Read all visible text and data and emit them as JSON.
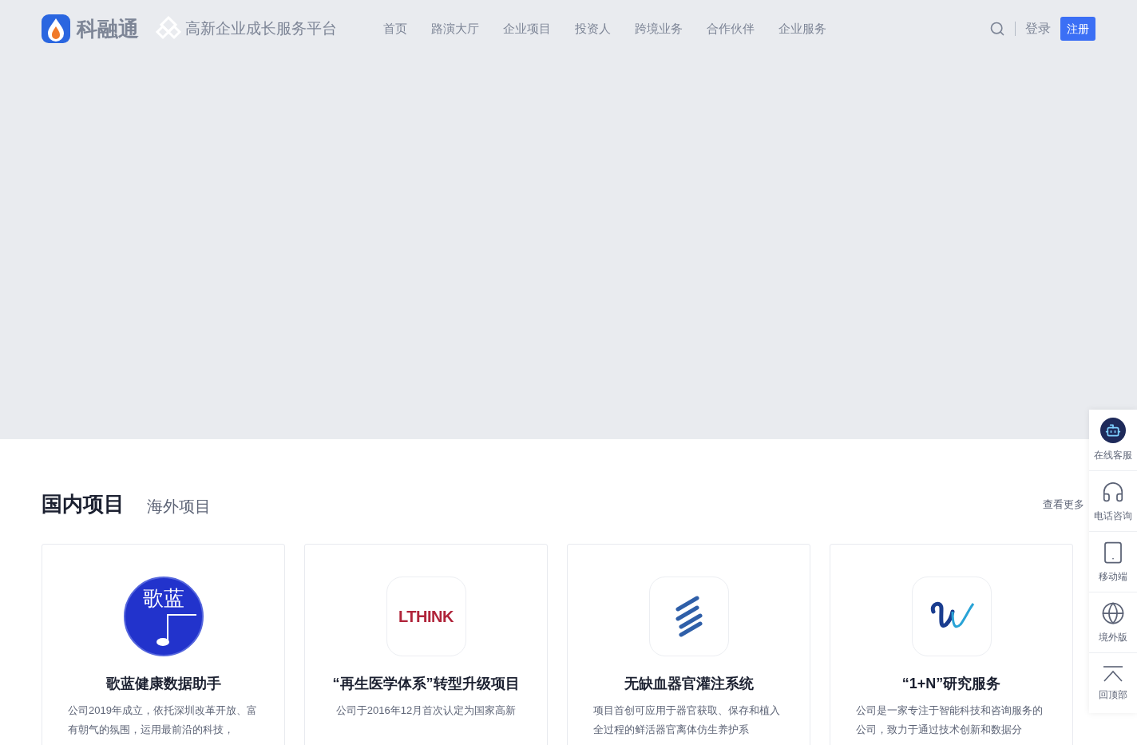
{
  "header": {
    "brand": "科融通",
    "slogan": "高新企业成长服务平台",
    "nav": [
      {
        "label": "首页"
      },
      {
        "label": "路演大厅"
      },
      {
        "label": "企业项目"
      },
      {
        "label": "投资人"
      },
      {
        "label": "跨境业务"
      },
      {
        "label": "合作伙伴"
      },
      {
        "label": "企业服务"
      }
    ],
    "login": "登录",
    "register": "注册"
  },
  "section": {
    "tabs": [
      {
        "label": "国内项目",
        "selected": true
      },
      {
        "label": "海外项目",
        "selected": false
      }
    ],
    "more": "查看更多",
    "cards": [
      {
        "kind": "gelan",
        "logo_text": "歌蓝",
        "title": "歌蓝健康数据助手",
        "description": "公司2019年成立，依托深圳改革开放、富有朝气的氛围，运用最前沿的科技，"
      },
      {
        "kind": "lthink",
        "logo_text": "LTHINK",
        "title": "“再生医学体系”转型升级项目",
        "description": "公司于2016年12月首次认定为国家高新"
      },
      {
        "kind": "stripes",
        "title": "无缺血器官灌注系统",
        "description": "项目首创可应用于器官获取、保存和植入全过程的鲜活器官离体仿生养护系"
      },
      {
        "kind": "w",
        "title": "“1+N”研究服务",
        "description": "公司是一家专注于智能科技和咨询服务的公司，致力于通过技术创新和数据分"
      }
    ]
  },
  "side_panel": [
    {
      "kind": "robot",
      "label": "在线客服"
    },
    {
      "kind": "headset",
      "label": "电话咨询"
    },
    {
      "kind": "phone",
      "label": "移动端"
    },
    {
      "kind": "globe",
      "label": "境外版"
    },
    {
      "kind": "top",
      "label": "回顶部"
    }
  ]
}
